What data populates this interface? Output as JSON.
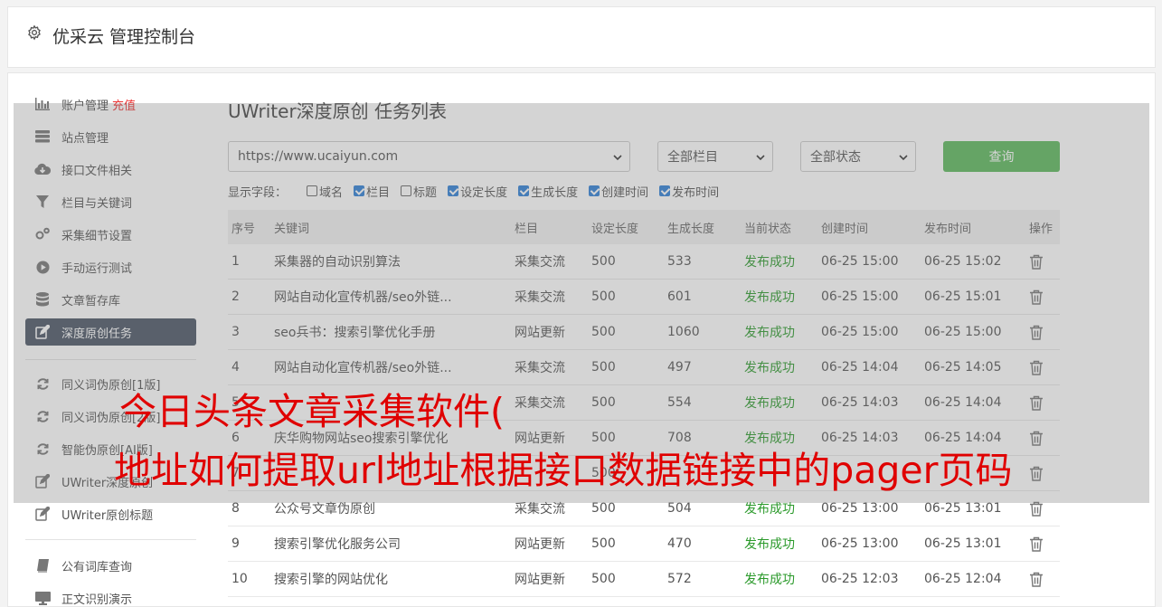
{
  "header": {
    "title": "优采云 管理控制台",
    "icon": "gear-icon"
  },
  "sidebar": {
    "items": [
      {
        "label": "账户管理",
        "badge": "充值",
        "icon": "bar-chart-icon"
      },
      {
        "label": "站点管理",
        "icon": "server-icon"
      },
      {
        "label": "接口文件相关",
        "icon": "cloud-download-icon"
      },
      {
        "label": "栏目与关键词",
        "icon": "filter-icon"
      },
      {
        "label": "采集细节设置",
        "icon": "gears-icon"
      },
      {
        "label": "手动运行测试",
        "icon": "play-circle-icon"
      },
      {
        "label": "文章暂存库",
        "icon": "database-icon"
      },
      {
        "label": "深度原创任务",
        "icon": "edit-icon",
        "active": true
      },
      {
        "label": "同义词伪原创[1版]",
        "icon": "refresh-icon"
      },
      {
        "label": "同义词伪原创[2版]",
        "icon": "refresh-icon"
      },
      {
        "label": "智能伪原创[AI版]",
        "icon": "refresh-icon"
      },
      {
        "label": "UWriter深度原创",
        "icon": "edit-icon"
      },
      {
        "label": "UWriter原创标题",
        "icon": "edit-icon"
      },
      {
        "label": "公有词库查询",
        "icon": "book-icon"
      },
      {
        "label": "正文识别演示",
        "icon": "monitor-icon"
      }
    ]
  },
  "main": {
    "title": "UWriter深度原创 任务列表",
    "site_select": "https://www.ucaiyun.com",
    "column_select": "全部栏目",
    "status_select": "全部状态",
    "query_label": "查询",
    "fields_label": "显示字段：",
    "fields": [
      {
        "label": "域名",
        "checked": false
      },
      {
        "label": "栏目",
        "checked": true
      },
      {
        "label": "标题",
        "checked": false
      },
      {
        "label": "设定长度",
        "checked": true
      },
      {
        "label": "生成长度",
        "checked": true
      },
      {
        "label": "创建时间",
        "checked": true
      },
      {
        "label": "发布时间",
        "checked": true
      }
    ]
  },
  "table": {
    "headers": [
      "序号",
      "关键词",
      "栏目",
      "设定长度",
      "生成长度",
      "当前状态",
      "创建时间",
      "发布时间",
      "操作"
    ],
    "rows": [
      [
        "1",
        "采集器的自动识别算法",
        "采集交流",
        "500",
        "533",
        "发布成功",
        "06-25 15:00",
        "06-25 15:02"
      ],
      [
        "2",
        "网站自动化宣传机器/seo外链...",
        "采集交流",
        "500",
        "601",
        "发布成功",
        "06-25 15:00",
        "06-25 15:01"
      ],
      [
        "3",
        "seo兵书：搜索引擎优化手册",
        "网站更新",
        "500",
        "1060",
        "发布成功",
        "06-25 15:00",
        "06-25 15:00"
      ],
      [
        "4",
        "网站自动化宣传机器/seo外链...",
        "采集交流",
        "500",
        "497",
        "发布成功",
        "06-25 14:04",
        "06-25 14:05"
      ],
      [
        "5",
        "",
        "采集交流",
        "500",
        "554",
        "发布成功",
        "06-25 14:03",
        "06-25 14:04"
      ],
      [
        "6",
        "庆华购物网站seo搜索引擎优化",
        "网站更新",
        "500",
        "708",
        "发布成功",
        "06-25 14:03",
        "06-25 14:04"
      ],
      [
        "7",
        "",
        "",
        "500",
        "",
        "",
        "",
        ""
      ],
      [
        "8",
        "公众号文章伪原创",
        "采集交流",
        "500",
        "504",
        "发布成功",
        "06-25 13:00",
        "06-25 13:01"
      ],
      [
        "9",
        "搜索引擎优化服务公司",
        "网站更新",
        "500",
        "470",
        "发布成功",
        "06-25 13:00",
        "06-25 13:01"
      ],
      [
        "10",
        "搜索引擎的网站优化",
        "网站更新",
        "500",
        "572",
        "发布成功",
        "06-25 12:03",
        "06-25 12:04"
      ]
    ]
  },
  "overlay": {
    "line1": "今日头条文章采集软件(",
    "line2": "地址如何提取url地址根据接口数据链接中的pager页码"
  }
}
